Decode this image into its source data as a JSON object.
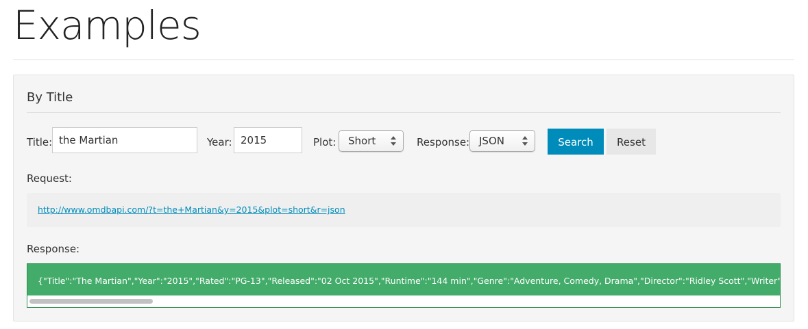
{
  "page": {
    "title": "Examples"
  },
  "panel": {
    "heading": "By Title",
    "form": {
      "title_label": "Title:",
      "title_value": "the Martian",
      "year_label": "Year:",
      "year_value": "2015",
      "plot_label": "Plot:",
      "plot_selected": "Short",
      "response_label": "Response:",
      "response_selected": "JSON",
      "search_button": "Search",
      "reset_button": "Reset"
    },
    "request": {
      "label": "Request:",
      "url": "http://www.omdbapi.com/?t=the+Martian&y=2015&plot=short&r=json"
    },
    "response": {
      "label": "Response:",
      "body": "{\"Title\":\"The Martian\",\"Year\":\"2015\",\"Rated\":\"PG-13\",\"Released\":\"02 Oct 2015\",\"Runtime\":\"144 min\",\"Genre\":\"Adventure, Comedy, Drama\",\"Director\":\"Ridley Scott\",\"Writer\":\"Drew Goddard (sc"
    }
  },
  "colors": {
    "accent": "#008cba",
    "success": "#43ac6a"
  },
  "icons": {
    "select_arrows": "updown-arrows-icon"
  }
}
